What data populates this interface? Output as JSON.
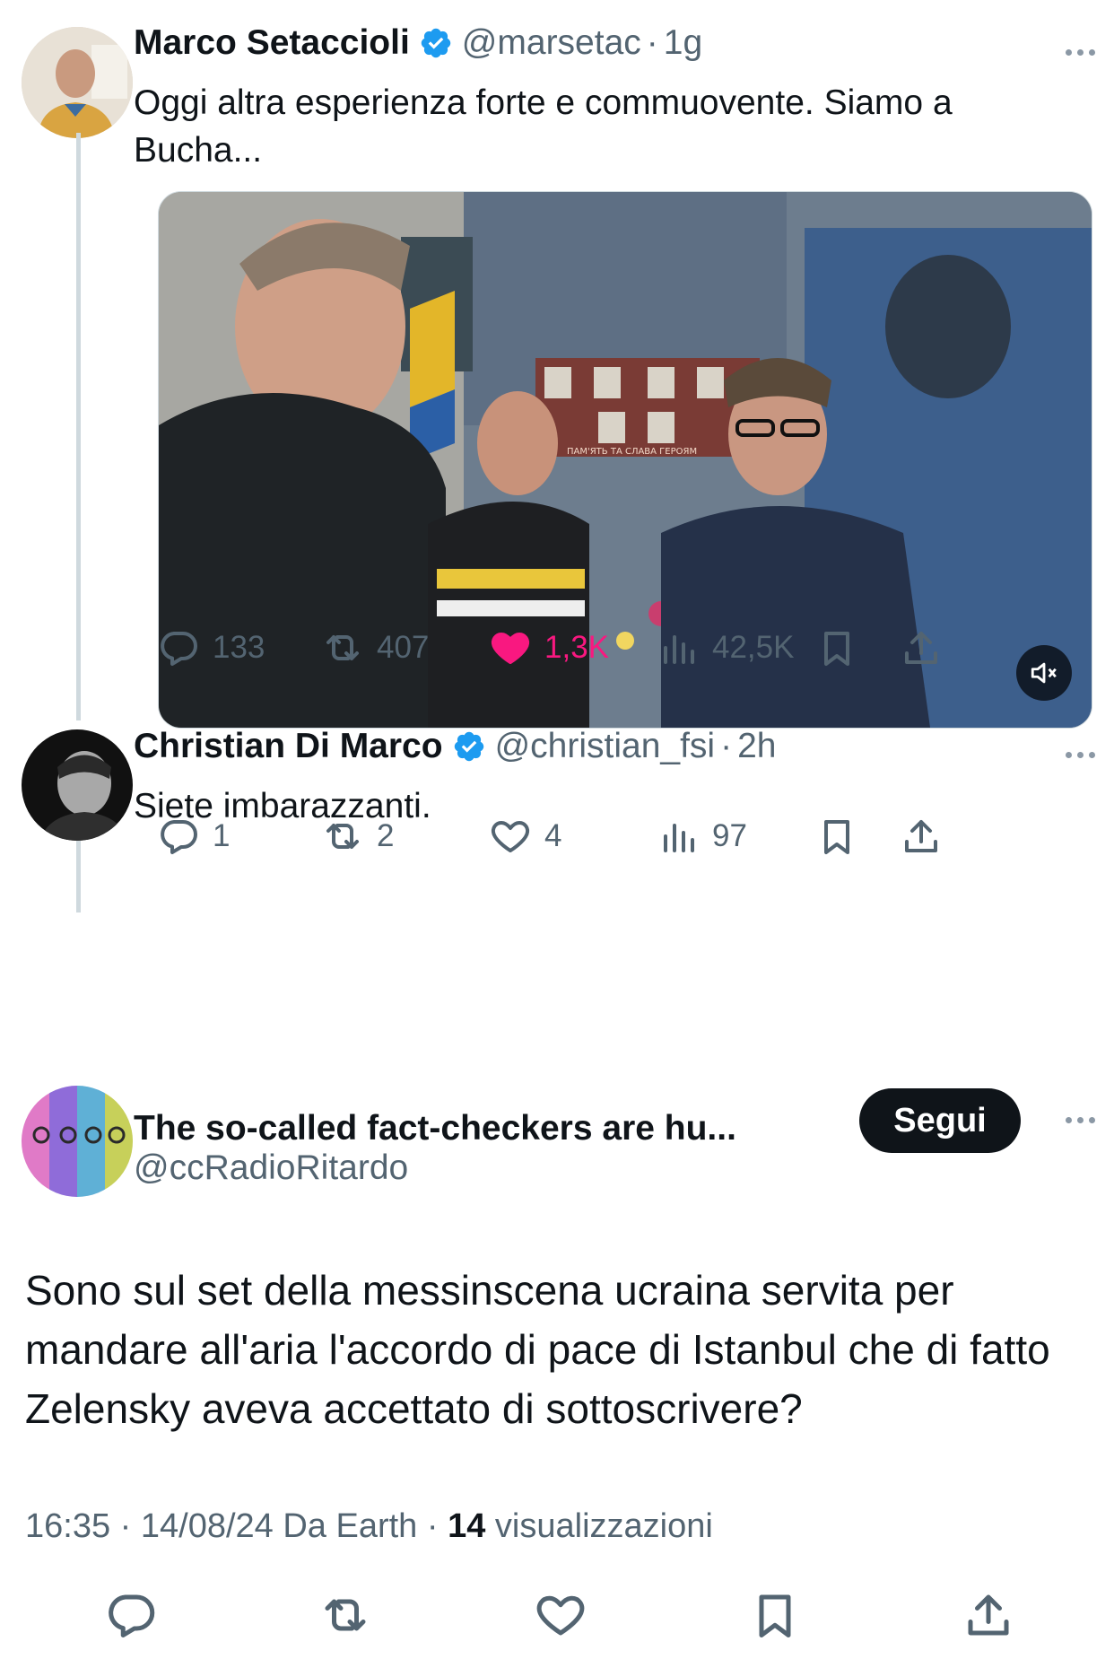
{
  "tweets": [
    {
      "name": "Marco Setaccioli",
      "handle": "@marsetac",
      "time": "1g",
      "text_line1": "Oggi altra esperienza forte e commuovente. Siamo a",
      "text_line2": "Bucha...",
      "video_banner_text": "ПАМ'ЯТЬ ТА СЛАВА ГЕРОЯМ",
      "stats": {
        "replies": "133",
        "retweets": "407",
        "likes": "1,3K",
        "views": "42,5K"
      }
    },
    {
      "name": "Christian Di Marco",
      "handle": "@christian_fsi",
      "time": "2h",
      "text": "Siete imbarazzanti.",
      "stats": {
        "replies": "1",
        "retweets": "2",
        "likes": "4",
        "views": "97"
      }
    },
    {
      "name": "The so-called fact-checkers are hu...",
      "handle": "@ccRadioRitardo",
      "follow_label": "Segui",
      "text": "Sono sul set della messinscena ucraina servita per mandare all'aria l'accordo di pace di Istanbul che di fatto Zelensky aveva accettato di sottoscrivere?",
      "meta_time": "16:35 · 14/08/24 Da Earth · ",
      "meta_views_count": "14",
      "meta_views_label": " visualizzazioni"
    }
  ],
  "colors": {
    "verified": "#1d9bf0",
    "like": "#f91880",
    "muted_text": "#536471",
    "line": "#cfd9de"
  },
  "icons": [
    "reply-icon",
    "retweet-icon",
    "like-icon",
    "views-icon",
    "bookmark-icon",
    "share-icon",
    "more-icon",
    "mute-icon",
    "verified-icon"
  ]
}
